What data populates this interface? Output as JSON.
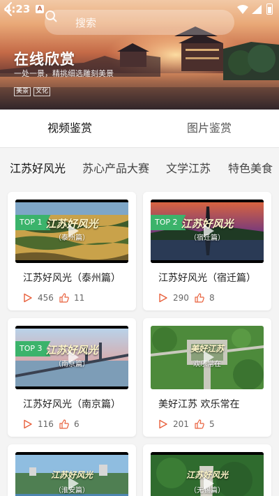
{
  "status_bar": {
    "time": "4:23",
    "notification": "A"
  },
  "search": {
    "placeholder": "搜索"
  },
  "hero": {
    "title": "在线欣赏",
    "subtitle": "一处一景，精挑细选雕刻美景",
    "tags": [
      "美景",
      "文化"
    ]
  },
  "main_tabs": [
    {
      "label": "视频鉴赏",
      "active": true
    },
    {
      "label": "图片鉴赏",
      "active": false
    }
  ],
  "sub_tabs": [
    {
      "label": "江苏好风光",
      "active": true
    },
    {
      "label": "苏心产品大赛",
      "active": false
    },
    {
      "label": "文学江苏",
      "active": false
    },
    {
      "label": "特色美食",
      "active": false
    }
  ],
  "cards": [
    {
      "title": "江苏好风光（泰州篇）",
      "badge": "TOP 1",
      "caption": "江苏好风光",
      "caption_sub": "（泰州篇）",
      "plays": "456",
      "likes": "11"
    },
    {
      "title": "江苏好风光（宿迁篇）",
      "badge": "TOP 2",
      "caption": "江苏好风光",
      "caption_sub": "（宿迁篇）",
      "plays": "290",
      "likes": "8"
    },
    {
      "title": "江苏好风光（南京篇）",
      "badge": "TOP 3",
      "caption": "江苏好风光",
      "caption_sub": "（南京篇）",
      "plays": "116",
      "likes": "6"
    },
    {
      "title": "美好江苏  欢乐常在",
      "badge": "",
      "caption": "美好江苏",
      "caption_sub": "欢乐常在",
      "plays": "201",
      "likes": "5"
    },
    {
      "title": "",
      "badge": "",
      "caption": "江苏好风光",
      "caption_sub": "（淮安篇）",
      "plays": "",
      "likes": ""
    },
    {
      "title": "",
      "badge": "",
      "caption": "江苏好风光",
      "caption_sub": "（无锡篇）",
      "plays": "",
      "likes": ""
    }
  ],
  "colors": {
    "accent": "#e8603c",
    "badge": "#3bb36b",
    "tab_indicator": "#111111"
  },
  "icons": {
    "back": "chevron-left-icon",
    "search": "search-icon",
    "play": "play-icon",
    "views": "triangle-play-icon",
    "likes": "thumb-up-icon"
  }
}
